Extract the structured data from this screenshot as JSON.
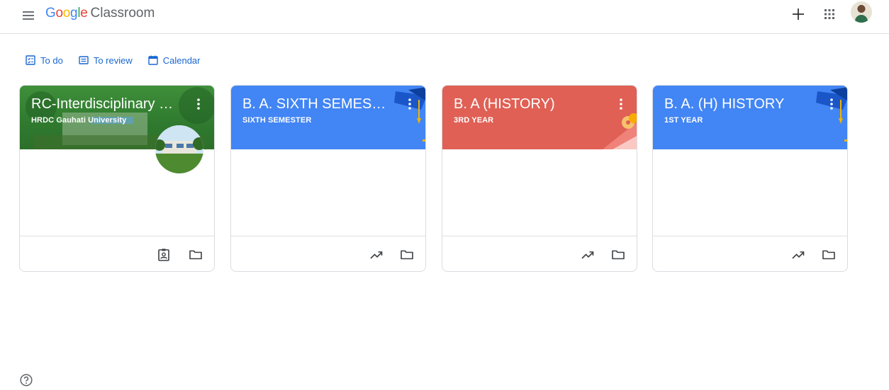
{
  "app": {
    "logo_letters": [
      "G",
      "o",
      "o",
      "g",
      "l",
      "e"
    ],
    "logo_colors": [
      "#4285F4",
      "#EA4335",
      "#FBBC05",
      "#4285F4",
      "#34A853",
      "#EA4335"
    ],
    "product": "Classroom"
  },
  "icons": {
    "menu": "hamburger-icon",
    "create": "plus-icon",
    "apps": "apps-grid-icon",
    "account": "avatar",
    "help": "help-icon"
  },
  "subnav": {
    "todo": "To do",
    "review": "To review",
    "calendar": "Calendar"
  },
  "classes": [
    {
      "title": "RC-Interdisciplinary S...",
      "section": "HRDC Gauhati University",
      "color": "#2e7d32",
      "footer_icons": [
        "assignment-ind-icon",
        "folder-icon"
      ]
    },
    {
      "title": "B. A. SIXTH SEMESTE...",
      "section": "SIXTH SEMESTER",
      "color": "#4285f4",
      "footer_icons": [
        "trending-up-icon",
        "folder-icon"
      ]
    },
    {
      "title": "B. A (HISTORY)",
      "section": "3RD YEAR",
      "color": "#e06055",
      "footer_icons": [
        "trending-up-icon",
        "folder-icon"
      ]
    },
    {
      "title": "B. A. (H) HISTORY",
      "section": "1ST YEAR",
      "color": "#4285f4",
      "footer_icons": [
        "trending-up-icon",
        "folder-icon"
      ]
    }
  ],
  "colors": {
    "accent": "#1967d2",
    "border": "#dadce0"
  }
}
